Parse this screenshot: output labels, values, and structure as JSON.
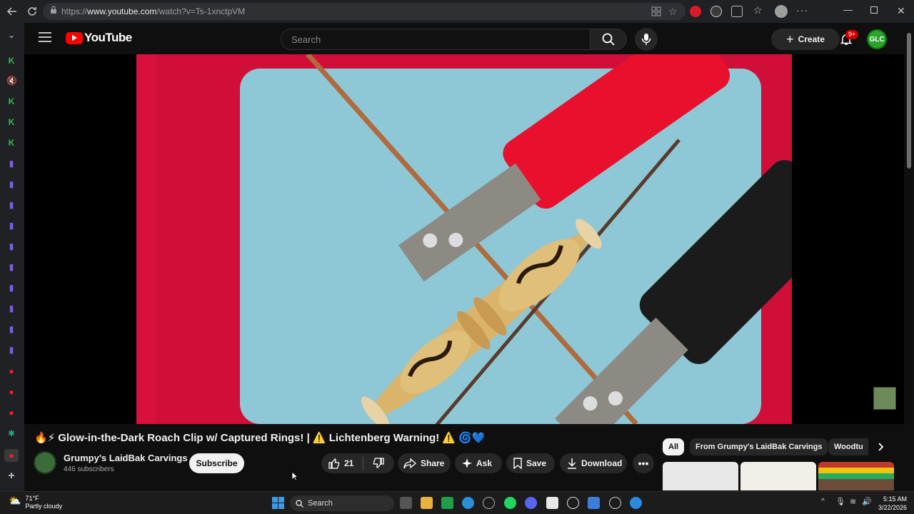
{
  "browser": {
    "url_prefix": "https://",
    "url_host": "www.youtube.com",
    "url_path": "/watch?v=Ts-1xnctpVM"
  },
  "masthead": {
    "logo_text": "YouTube",
    "search_placeholder": "Search",
    "create_label": "Create",
    "notifications_badge": "9+",
    "avatar_initials": "GLC"
  },
  "video": {
    "title_prefix": "🔥⚡",
    "title": "Glow-in-the-Dark Roach Clip w/ Captured Rings! | ⚠️ Lichtenberg Warning! ⚠️",
    "title_suffix": "🌀💙"
  },
  "channel": {
    "name": "Grumpy's LaidBak Carvings",
    "subscribers": "446 subscribers",
    "subscribe_label": "Subscribe"
  },
  "actions": {
    "likes": "21",
    "share": "Share",
    "ask": "Ask",
    "save": "Save",
    "download": "Download"
  },
  "chips": [
    {
      "label": "All"
    },
    {
      "label": "From Grumpy's LaidBak Carvings"
    },
    {
      "label": "Woodtu"
    }
  ],
  "taskbar": {
    "temp": "71°F",
    "condition": "Partly cloudy",
    "search": "Search",
    "time": "5:15 AM",
    "date": "3/22/2026"
  },
  "colors": {
    "yt_red": "#ff0000",
    "bg": "#0f0f0f",
    "pill": "#272727"
  }
}
